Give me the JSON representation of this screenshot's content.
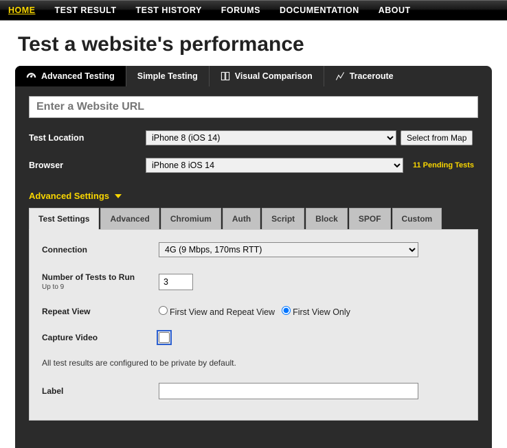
{
  "nav": {
    "items": [
      {
        "label": "HOME",
        "active": true
      },
      {
        "label": "TEST RESULT",
        "active": false
      },
      {
        "label": "TEST HISTORY",
        "active": false
      },
      {
        "label": "FORUMS",
        "active": false
      },
      {
        "label": "DOCUMENTATION",
        "active": false
      },
      {
        "label": "ABOUT",
        "active": false
      }
    ]
  },
  "page": {
    "title": "Test a website's performance"
  },
  "modeTabs": [
    {
      "label": "Advanced Testing"
    },
    {
      "label": "Simple Testing"
    },
    {
      "label": "Visual Comparison"
    },
    {
      "label": "Traceroute"
    }
  ],
  "form": {
    "url_placeholder": "Enter a Website URL",
    "location_label": "Test Location",
    "location_value": "iPhone 8 (iOS 14)",
    "map_button": "Select from Map",
    "browser_label": "Browser",
    "browser_value": "iPhone 8 iOS 14",
    "pending_text": "11 Pending Tests",
    "advanced_toggle": "Advanced Settings"
  },
  "settingsTabs": [
    "Test Settings",
    "Advanced",
    "Chromium",
    "Auth",
    "Script",
    "Block",
    "SPOF",
    "Custom"
  ],
  "settings": {
    "connection_label": "Connection",
    "connection_value": "4G (9 Mbps, 170ms RTT)",
    "runs_label": "Number of Tests to Run",
    "runs_sub": "Up to 9",
    "runs_value": "3",
    "repeat_label": "Repeat View",
    "repeat_opt1": "First View and Repeat View",
    "repeat_opt2": "First View Only",
    "capture_label": "Capture Video",
    "private_note": "All test results are configured to be private by default.",
    "label_label": "Label"
  }
}
